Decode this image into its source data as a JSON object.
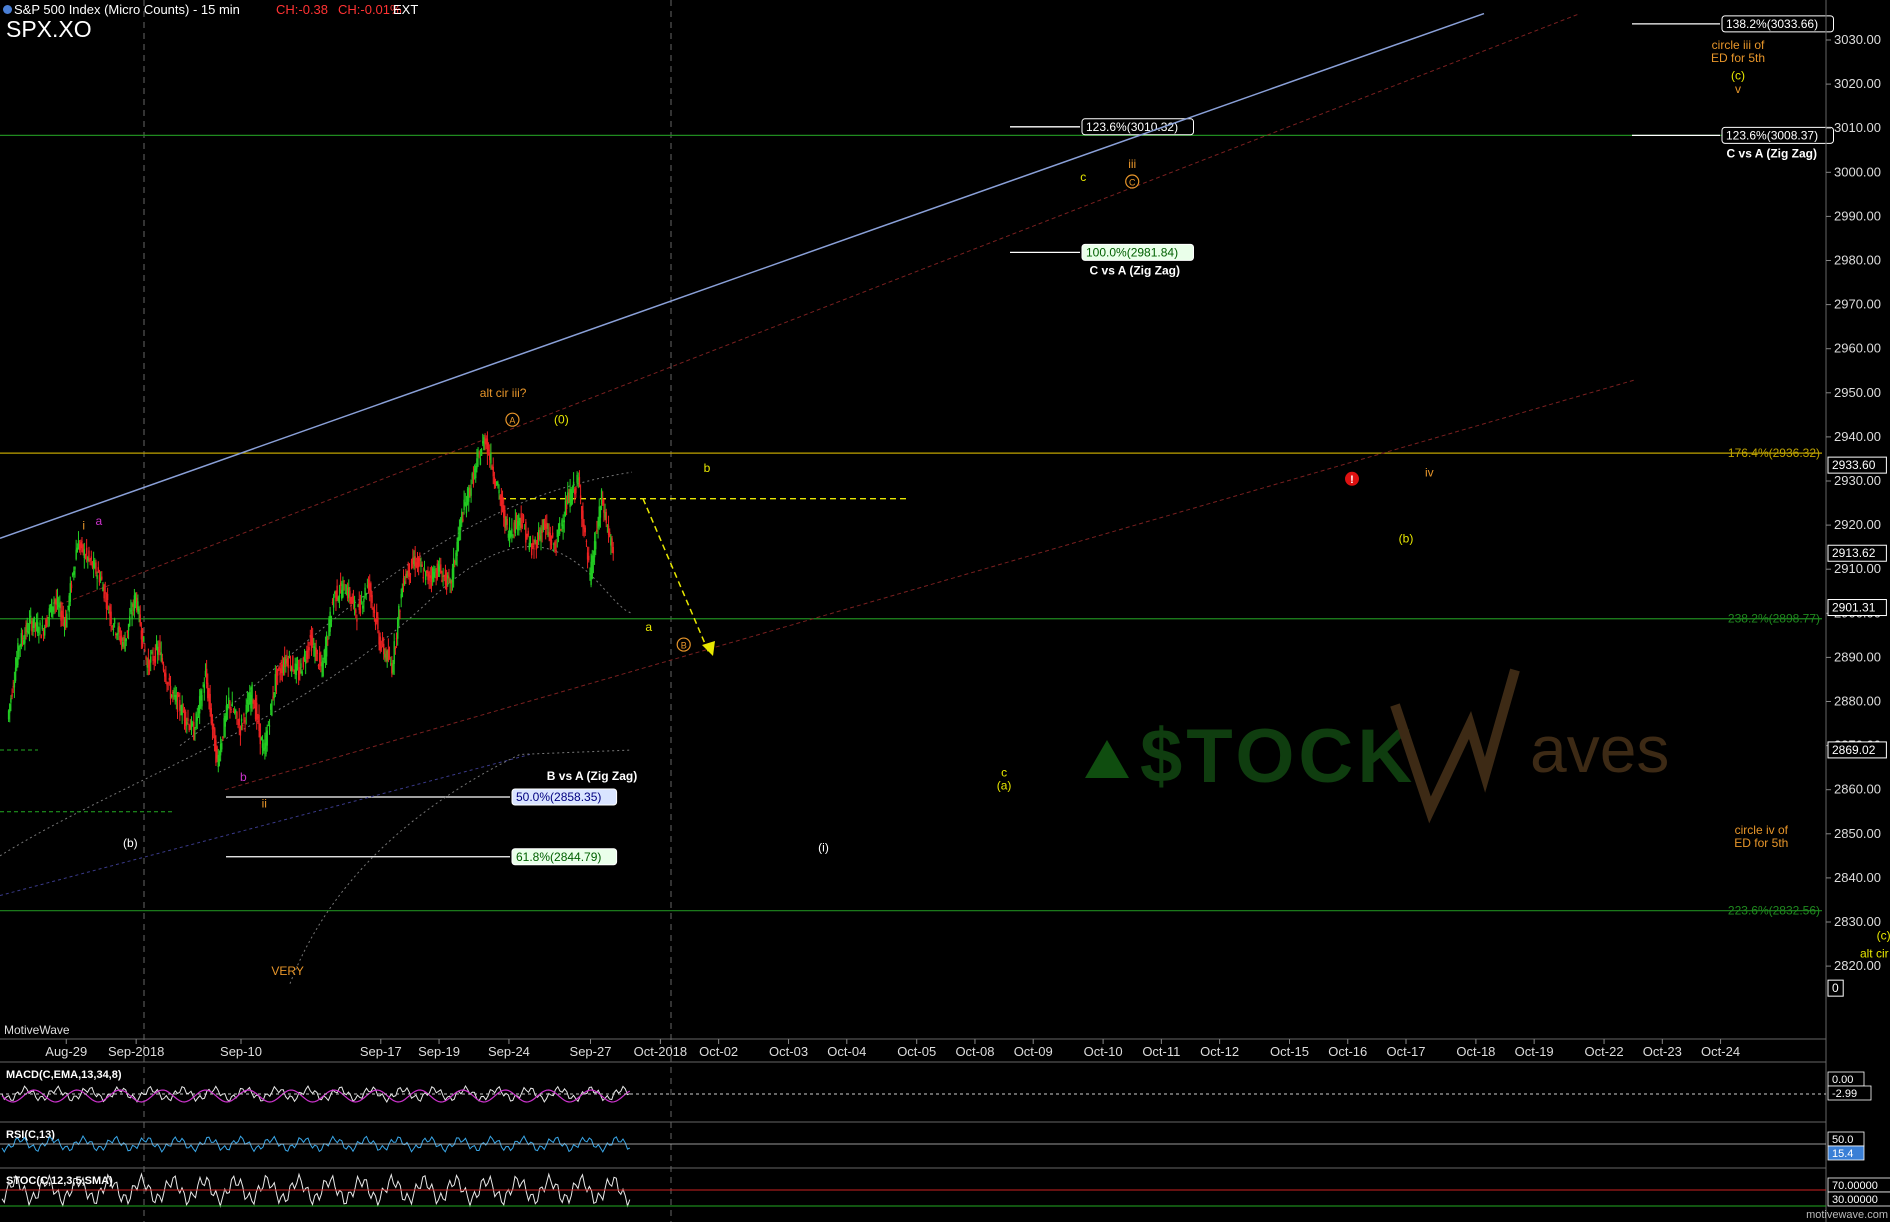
{
  "header": {
    "title": "S&P 500 Index (Micro Counts) - 15 min",
    "change1": "CH:-0.38",
    "change2": "CH:-0.01%",
    "session": "EXT",
    "symbol": "SPX.XO"
  },
  "footer": {
    "brand_left": "MotiveWave",
    "brand_right": "motivewave.com",
    "watermark": "STOCKWaves"
  },
  "colors": {
    "background": "#000000",
    "candle_up": "#22cc22",
    "candle_down": "#ee2222",
    "fib_green": "#008800",
    "fib_yellow": "#bfa300",
    "channel_blue": "#8aa0d8",
    "orange": "#e8962a",
    "magenta": "#cc33cc",
    "yellow": "#e8e800"
  },
  "chart_data": {
    "type": "line",
    "title": "S&P 500 Index (Micro Counts) - 15 min",
    "ylim": [
      2812,
      3036
    ],
    "y_ticks": [
      2820,
      2830,
      2840,
      2850,
      2860,
      2870,
      2880,
      2890,
      2900,
      2910,
      2920,
      2930,
      2940,
      2950,
      2960,
      2970,
      2980,
      2990,
      3000,
      3010,
      3020,
      3030
    ],
    "y_tick_labels": [
      "2820.00",
      "2830.00",
      "2840.00",
      "2850.00",
      "2860.00",
      "2870.00",
      "2880.00",
      "2890.00",
      "2900.00",
      "2910.00",
      "2920.00",
      "2930.00",
      "2940.00",
      "2950.00",
      "2960.00",
      "2970.00",
      "2980.00",
      "2990.00",
      "3000.00",
      "3010.00",
      "3020.00",
      "3030.00"
    ],
    "x_labels": [
      "Aug-29",
      "Sep-2018",
      "Sep-10",
      "Sep-17",
      "Sep-19",
      "Sep-24",
      "Sep-27",
      "Oct-2018",
      "Oct-02",
      "Oct-03",
      "Oct-04",
      "Oct-05",
      "Oct-08",
      "Oct-09",
      "Oct-10",
      "Oct-11",
      "Oct-12",
      "Oct-15",
      "Oct-16",
      "Oct-17",
      "Oct-18",
      "Oct-19",
      "Oct-22",
      "Oct-23",
      "Oct-24"
    ],
    "x_label_index": [
      5,
      11,
      20,
      32,
      37,
      43,
      50,
      56,
      61,
      67,
      72,
      78,
      83,
      88,
      94,
      99,
      104,
      110,
      115,
      120,
      126,
      131,
      137,
      142,
      147
    ],
    "x_count": 153,
    "price_path": [
      [
        0,
        2876
      ],
      [
        1,
        2893
      ],
      [
        2,
        2898
      ],
      [
        3,
        2896
      ],
      [
        4,
        2903
      ],
      [
        5,
        2898
      ],
      [
        6,
        2916
      ],
      [
        7,
        2912
      ],
      [
        8,
        2908
      ],
      [
        9,
        2898
      ],
      [
        10,
        2893
      ],
      [
        11,
        2904
      ],
      [
        12,
        2888
      ],
      [
        13,
        2892
      ],
      [
        14,
        2882
      ],
      [
        15,
        2878
      ],
      [
        16,
        2873
      ],
      [
        17,
        2886
      ],
      [
        18,
        2866
      ],
      [
        19,
        2880
      ],
      [
        20,
        2874
      ],
      [
        21,
        2882
      ],
      [
        22,
        2868
      ],
      [
        23,
        2885
      ],
      [
        24,
        2890
      ],
      [
        25,
        2886
      ],
      [
        26,
        2894
      ],
      [
        27,
        2887
      ],
      [
        28,
        2904
      ],
      [
        29,
        2906
      ],
      [
        30,
        2900
      ],
      [
        31,
        2907
      ],
      [
        32,
        2893
      ],
      [
        33,
        2888
      ],
      [
        34,
        2908
      ],
      [
        35,
        2912
      ],
      [
        36,
        2908
      ],
      [
        37,
        2910
      ],
      [
        38,
        2906
      ],
      [
        39,
        2922
      ],
      [
        40,
        2931
      ],
      [
        41,
        2940
      ],
      [
        42,
        2929
      ],
      [
        43,
        2918
      ],
      [
        44,
        2922
      ],
      [
        45,
        2914
      ],
      [
        46,
        2920
      ],
      [
        47,
        2915
      ],
      [
        48,
        2925
      ],
      [
        49,
        2930
      ],
      [
        50,
        2908
      ],
      [
        51,
        2926
      ],
      [
        52,
        2913
      ]
    ],
    "fib_levels": [
      {
        "label": "176.4%(2936.32)",
        "value": 2936.32
      },
      {
        "label": "238.2%(2898.77)",
        "value": 2898.77
      },
      {
        "label": "223.6%(2832.56)",
        "value": 2832.56
      }
    ],
    "fib_callouts": [
      {
        "label": "138.2%(3033.66)",
        "value": 3033.66
      },
      {
        "label": "123.6%(3008.37)",
        "value": 3008.37,
        "caption": "C vs A (Zig Zag)"
      },
      {
        "label": "123.6%(3010.32)",
        "value": 3010.32
      },
      {
        "label": "100.0%(2981.84)",
        "value": 2981.84,
        "caption": "C vs A (Zig Zag)"
      },
      {
        "label": "50.0%(2858.35)",
        "value": 2858.35,
        "caption": "B vs A (Zig Zag)"
      },
      {
        "label": "61.8%(2844.79)",
        "value": 2844.79
      }
    ],
    "price_tags": [
      {
        "label": "2933.60",
        "value": 2933.6
      },
      {
        "label": "2913.62",
        "value": 2913.62
      },
      {
        "label": "2901.31",
        "value": 2901.31
      },
      {
        "label": "2869.02",
        "value": 2869.02
      },
      {
        "label": "0",
        "value": 2815
      }
    ],
    "wave_labels": [
      {
        "text": "i",
        "x": 6.5,
        "y": 2919
      },
      {
        "text": "a",
        "x": 7.8,
        "y": 2920
      },
      {
        "text": "b",
        "x": 20.2,
        "y": 2862
      },
      {
        "text": "ii",
        "x": 22,
        "y": 2856
      },
      {
        "text": "(b)",
        "x": 10.5,
        "y": 2847
      },
      {
        "text": "VERY",
        "x": 24,
        "y": 2818
      },
      {
        "text": "alt cir iii?",
        "x": 42.5,
        "y": 2949
      },
      {
        "text": "A",
        "x": 43.3,
        "y": 2943
      },
      {
        "text": "(0)",
        "x": 47.5,
        "y": 2943
      },
      {
        "text": "b",
        "x": 60,
        "y": 2932
      },
      {
        "text": "a",
        "x": 55,
        "y": 2896
      },
      {
        "text": "B",
        "x": 58,
        "y": 2892
      },
      {
        "text": "B vs A (Zig Zag)",
        "x": 50.5,
        "y": 2862
      },
      {
        "text": "(i)",
        "x": 70,
        "y": 2846
      },
      {
        "text": "c",
        "x": 85.5,
        "y": 2863
      },
      {
        "text": "(a)",
        "x": 85.5,
        "y": 2860
      },
      {
        "text": "c",
        "x": 92.3,
        "y": 2998
      },
      {
        "text": "iii",
        "x": 96.5,
        "y": 3001
      },
      {
        "text": "C",
        "x": 96.5,
        "y": 2997
      },
      {
        "text": "iv",
        "x": 122,
        "y": 2931
      },
      {
        "text": "(b)",
        "x": 120,
        "y": 2916
      },
      {
        "text": "circle iii of",
        "x": 148.5,
        "y": 3028
      },
      {
        "text": "ED for 5th",
        "x": 148.5,
        "y": 3025
      },
      {
        "text": "(c)",
        "x": 148.5,
        "y": 3021
      },
      {
        "text": "v",
        "x": 148.5,
        "y": 3018
      },
      {
        "text": "circle iv of",
        "x": 150.5,
        "y": 2850
      },
      {
        "text": "ED for 5th",
        "x": 150.5,
        "y": 2847
      },
      {
        "text": "(c)",
        "x": 161,
        "y": 2826
      },
      {
        "text": "alt cir iv?",
        "x": 161,
        "y": 2822
      }
    ]
  },
  "indicators": [
    {
      "name": "MACD(C,EMA,13,34,8)",
      "tags": [
        "0.00",
        "-2.99"
      ]
    },
    {
      "name": "RSI(C,13)",
      "tags": [
        "50.0",
        "15.4"
      ]
    },
    {
      "name": "STOC(C,12,3,5,SMA)",
      "tags": [
        "70.00000",
        "30.00000"
      ]
    }
  ]
}
